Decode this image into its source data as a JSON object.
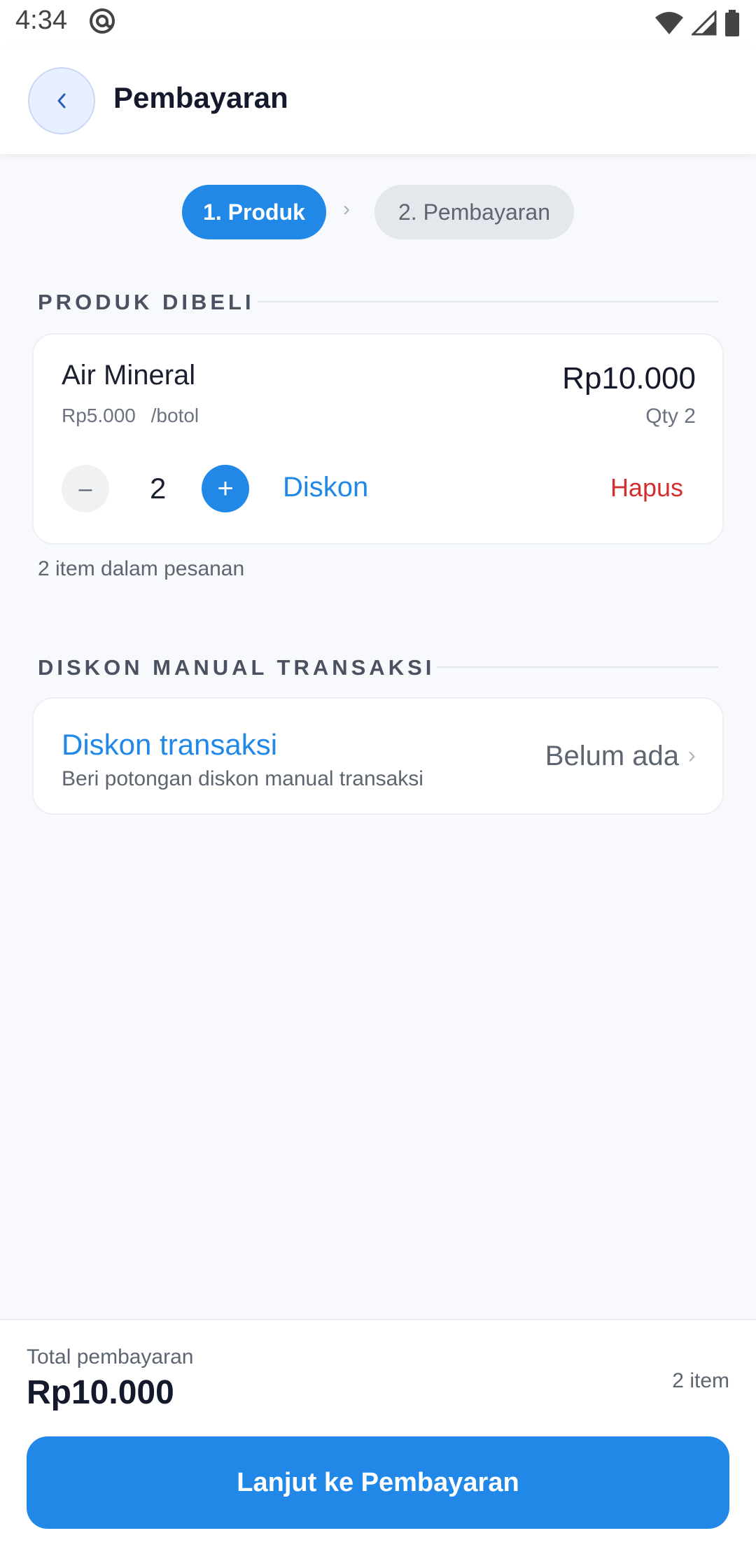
{
  "status_bar": {
    "time": "4:34",
    "icons": [
      "at-sign-icon",
      "wifi-icon",
      "signal-icon",
      "battery-icon"
    ]
  },
  "header": {
    "back_icon": "chevron-left-icon",
    "title": "Pembayaran"
  },
  "stepper": {
    "steps": [
      {
        "label": "1. Produk",
        "active": true
      },
      {
        "label": "2. Pembayaran",
        "active": false
      }
    ],
    "separator": "›"
  },
  "products_section": {
    "heading": "PRODUK DIBELI",
    "items": [
      {
        "name": "Air Mineral",
        "unit_price": "Rp5.000",
        "unit": "/botol",
        "total": "Rp10.000",
        "qty_label": "Qty 2",
        "qty": "2",
        "minus": "–",
        "plus": "+",
        "discount_label": "Diskon",
        "delete_label": "Hapus"
      }
    ],
    "item_count_text": "2 item dalam pesanan"
  },
  "discount_section": {
    "heading": "DISKON MANUAL TRANSAKSI",
    "title": "Diskon transaksi",
    "subtitle": "Beri potongan diskon manual transaksi",
    "value": "Belum ada",
    "chevron": "›"
  },
  "footer": {
    "total_label": "Total pembayaran",
    "total_value": "Rp10.000",
    "item_count": "2 item",
    "cta_label": "Lanjut ke Pembayaran"
  },
  "colors": {
    "accent": "#2188e8",
    "danger": "#d32f2f",
    "background": "#f7f9fc"
  }
}
